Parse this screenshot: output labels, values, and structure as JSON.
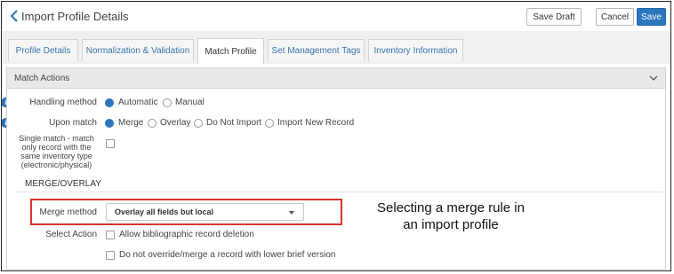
{
  "header": {
    "title": "Import Profile Details",
    "buttons": {
      "save_draft": "Save Draft",
      "cancel": "Cancel",
      "save": "Save"
    }
  },
  "tabs": [
    {
      "label": "Profile Details",
      "active": false
    },
    {
      "label": "Normalization & Validation",
      "active": false
    },
    {
      "label": "Match Profile",
      "active": true
    },
    {
      "label": "Set Management Tags",
      "active": false
    },
    {
      "label": "Inventory Information",
      "active": false
    }
  ],
  "panel": {
    "title": "Match Actions",
    "handling_method": {
      "label": "Handling method",
      "options": [
        {
          "label": "Automatic",
          "selected": true
        },
        {
          "label": "Manual",
          "selected": false
        }
      ]
    },
    "upon_match": {
      "label": "Upon match",
      "options": [
        {
          "label": "Merge",
          "selected": true
        },
        {
          "label": "Overlay",
          "selected": false
        },
        {
          "label": "Do Not Import",
          "selected": false
        },
        {
          "label": "Import New Record",
          "selected": false
        }
      ]
    },
    "single_match": {
      "label_lines": [
        "Single match - match",
        "only record with the",
        "same inventory type",
        "(electronic/physical)"
      ],
      "checked": false
    },
    "section_heading": "MERGE/OVERLAY",
    "merge_method": {
      "label": "Merge method",
      "value": "Overlay all fields but local"
    },
    "select_action": {
      "label": "Select Action",
      "options": [
        {
          "label": "Allow bibliographic record deletion",
          "checked": false
        },
        {
          "label": "Do not override/merge a record with lower brief version",
          "checked": false
        }
      ]
    }
  },
  "annotation": {
    "lines": [
      "Selecting a merge rule in",
      "an import profile"
    ],
    "highlight_color": "#d9342b"
  },
  "colors": {
    "accent": "#2b76bd",
    "link": "#3a72ad"
  }
}
